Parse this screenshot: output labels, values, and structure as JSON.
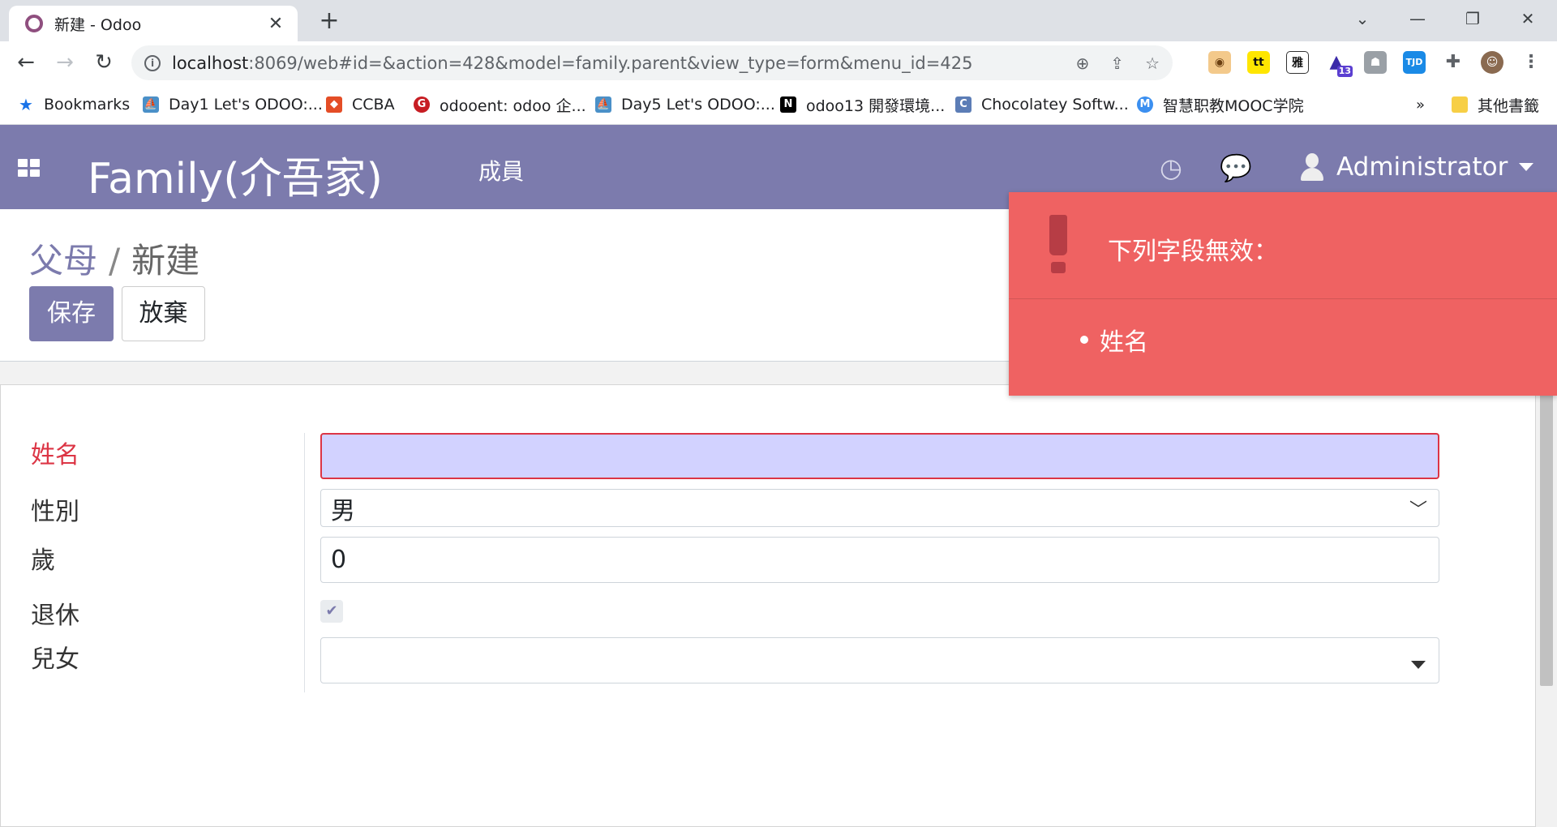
{
  "browser": {
    "tab_title": "新建 - Odoo",
    "url_host": "localhost",
    "url_rest": ":8069/web#id=&action=428&model=family.parent&view_type=form&menu_id=425",
    "bookmarks": [
      {
        "label": "Bookmarks",
        "icon": "star-icon",
        "color": "#1a73e8"
      },
      {
        "label": "Day1 Let's ODOO:...",
        "icon": "ithome-icon",
        "color": "#4a90c8"
      },
      {
        "label": "CCBA",
        "icon": "ccba-icon",
        "color": "#e44d26"
      },
      {
        "label": "odooent: odoo 企...",
        "icon": "gitee-icon",
        "color": "#c71d23"
      },
      {
        "label": "Day5 Let's ODOO:...",
        "icon": "ithome-icon",
        "color": "#4a90c8"
      },
      {
        "label": "odoo13 開發環境...",
        "icon": "notion-icon",
        "color": "#000000"
      },
      {
        "label": "Chocolatey Softw...",
        "icon": "chocolatey-icon",
        "color": "#5c7db6"
      },
      {
        "label": "智慧职教MOOC学院",
        "icon": "mooc-icon",
        "color": "#3b8ff0"
      }
    ],
    "other_bookmarks": "其他書籤",
    "ext_badge": "13"
  },
  "app": {
    "brand": "Family(介吾家)",
    "menu": [
      "成員"
    ],
    "user": "Administrator"
  },
  "breadcrumb": {
    "parent": "父母",
    "current": "新建"
  },
  "buttons": {
    "save": "保存",
    "discard": "放棄"
  },
  "form": {
    "labels": {
      "name": "姓名",
      "gender": "性別",
      "age": "歲",
      "retired": "退休",
      "children": "兒女"
    },
    "values": {
      "name": "",
      "gender": "男",
      "age": "0",
      "retired": true,
      "children": ""
    }
  },
  "notification": {
    "title": "下列字段無效：",
    "invalid_fields": [
      "姓名"
    ],
    "color": "#ef6262"
  },
  "colors": {
    "accent": "#7c7bad",
    "danger": "#dc3545"
  }
}
